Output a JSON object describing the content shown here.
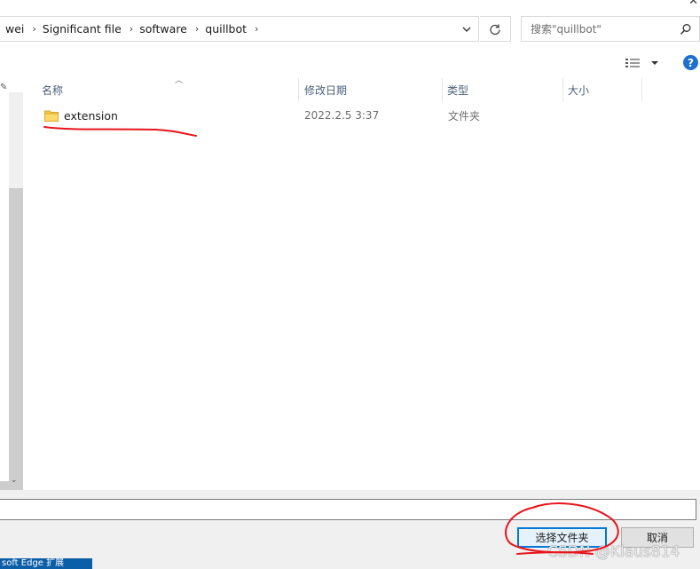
{
  "breadcrumb": [
    "wei",
    "Significant file",
    "software",
    "quillbot"
  ],
  "search": {
    "placeholder": "搜索\"quillbot\""
  },
  "columns": {
    "name": "名称",
    "modified": "修改日期",
    "type": "类型",
    "size": "大小"
  },
  "files": [
    {
      "name": "extension",
      "modified": "2022.2.5 3:37",
      "type": "文件夹",
      "size": ""
    }
  ],
  "folder_field": {
    "value": ""
  },
  "buttons": {
    "select_folder": "选择文件夹",
    "cancel": "取消"
  },
  "taskbar": {
    "edge_label": "soft Edge 扩展"
  },
  "watermark": "CSDN @Klaus814",
  "colors": {
    "accent": "#0078d7",
    "help": "#1e6fd1",
    "annotation": "#e8141b",
    "folder": "#f5c84c"
  },
  "icons": [
    "chevron-right-icon",
    "chevron-down-icon",
    "refresh-icon",
    "search-icon",
    "view-options-icon",
    "help-icon",
    "folder-icon",
    "pin-icon",
    "sort-up-icon"
  ]
}
